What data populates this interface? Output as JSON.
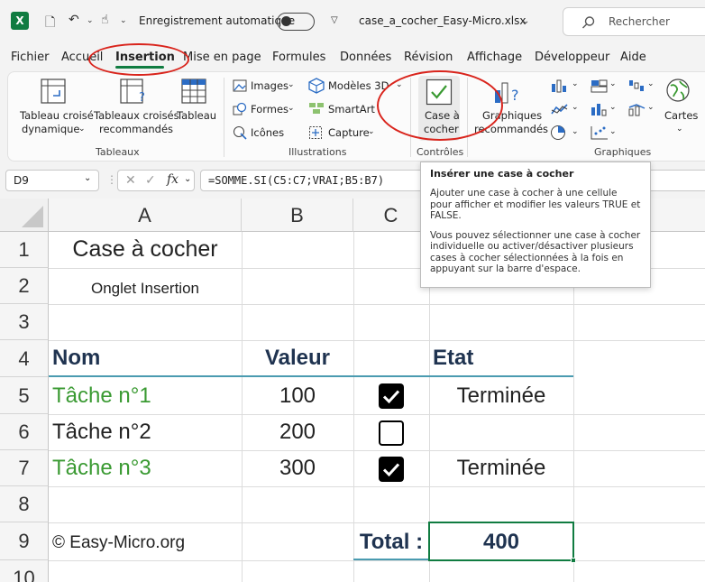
{
  "titlebar": {
    "autosave_label": "Enregistrement automatique",
    "filename": "case_a_cocher_Easy-Micro.xlsx",
    "search_placeholder": "Rechercher"
  },
  "menu": {
    "tabs": [
      "Fichier",
      "Accueil",
      "Insertion",
      "Mise en page",
      "Formules",
      "Données",
      "Révision",
      "Affichage",
      "Développeur",
      "Aide"
    ],
    "active": "Insertion"
  },
  "ribbon": {
    "tableaux": {
      "pivot_line1": "Tableau croisé",
      "pivot_line2": "dynamique",
      "rec_pivot_line1": "Tableaux croisés",
      "rec_pivot_line2": "recommandés",
      "table": "Tableau",
      "group": "Tableaux"
    },
    "illustrations": {
      "images": "Images",
      "formes": "Formes",
      "icones": "Icônes",
      "modeles3d": "Modèles 3D",
      "smartart": "SmartArt",
      "capture": "Capture",
      "group": "Illustrations"
    },
    "controles": {
      "checkbox_line1": "Case à",
      "checkbox_line2": "cocher",
      "group": "Contrôles"
    },
    "graphiques": {
      "rec_line1": "Graphiques",
      "rec_line2": "recommandés",
      "cartes": "Cartes",
      "group": "Graphiques"
    }
  },
  "formula_bar": {
    "name_box": "D9",
    "fx": "fx",
    "formula": "=SOMME.SI(C5:C7;VRAI;B5:B7)"
  },
  "tooltip": {
    "title": "Insérer une case à cocher",
    "para1": "Ajouter une case à cocher à une cellule pour afficher et modifier les valeurs TRUE et FALSE.",
    "para2": "Vous pouvez sélectionner une case à cocher individuelle ou activer/désactiver plusieurs cases à cocher sélectionnées à la fois en appuyant sur la barre d'espace."
  },
  "sheet": {
    "columns": [
      "A",
      "B",
      "C"
    ],
    "rows": [
      "1",
      "2",
      "3",
      "4",
      "5",
      "6",
      "7",
      "8",
      "9",
      "10"
    ],
    "title": "Case à cocher",
    "subtitle": "Onglet Insertion",
    "headers": {
      "nom": "Nom",
      "valeur": "Valeur",
      "etat": "Etat"
    },
    "tasks": [
      {
        "nom": "Tâche n°1",
        "valeur": "100",
        "checked": true,
        "etat": "Terminée"
      },
      {
        "nom": "Tâche n°2",
        "valeur": "200",
        "checked": false,
        "etat": ""
      },
      {
        "nom": "Tâche n°3",
        "valeur": "300",
        "checked": true,
        "etat": "Terminée"
      }
    ],
    "copyright": "© Easy-Micro.org",
    "total_label": "Total :",
    "total_value": "400"
  },
  "colors": {
    "excel_green": "#107c41",
    "done_green": "#3a9a32",
    "header_navy": "#1f3350",
    "annotation_red": "#d9241c",
    "teal_border": "#4a9bb0"
  }
}
